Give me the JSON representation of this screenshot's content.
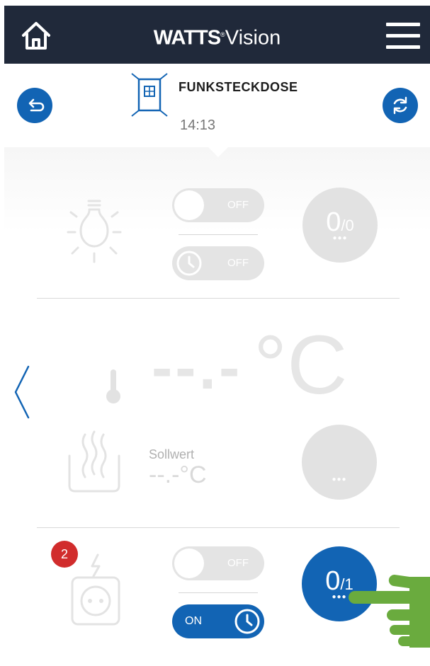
{
  "header": {
    "brand_bold": "WATTS",
    "brand_reg": "®",
    "brand_light": "Vision"
  },
  "device": {
    "title": "FUNKSTECKDOSE",
    "time": "14:13"
  },
  "light": {
    "toggle_label": "OFF",
    "timer_label": "OFF",
    "count_main": "0",
    "count_sub": "/0",
    "dots": "●●●"
  },
  "temperature": {
    "value": "--.-",
    "unit": "°C",
    "setpoint_label": "Sollwert",
    "setpoint_value": "--.-°C",
    "dots": "●●●"
  },
  "socket": {
    "badge_count": "2",
    "toggle_label": "OFF",
    "timer_label": "ON",
    "count_main": "0",
    "count_sub": "/1",
    "dots": "●●●"
  },
  "colors": {
    "topbar": "#20293a",
    "accent": "#1264b4",
    "badge": "#d12c2c",
    "pointer_hand": "#6aab3e"
  }
}
